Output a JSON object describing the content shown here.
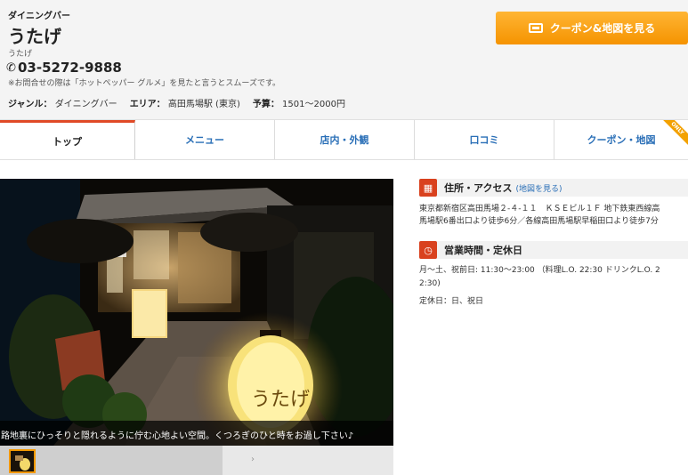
{
  "header": {
    "genre_small": "ダイニングバー",
    "shop_name": "うたげ",
    "shop_kana": "うたげ",
    "phone": "03-5272-9888",
    "phone_note": "※お問合せの際は「ホットペッパー グルメ」を見たと言うとスムーズです。",
    "genre_label": "ジャンル：",
    "genre_value": "ダイニングバー",
    "area_label": "エリア：",
    "area_value": "高田馬場駅 (東京)",
    "budget_label": "予算：",
    "budget_value": "1501～2000円",
    "coupon_button": "クーポン&地図を見る"
  },
  "tabs": [
    {
      "label": "トップ",
      "active": true
    },
    {
      "label": "メニュー"
    },
    {
      "label": "店内・外観"
    },
    {
      "label": "口コミ"
    },
    {
      "label": "クーポン・地図",
      "badge": "ONLY"
    }
  ],
  "photo": {
    "caption": "路地裏にひっそりと隠れるように佇む心地よい空間。くつろぎのひと時をお過し下さい♪",
    "lantern_text": "うたげ",
    "thumbnail_arrow": "›"
  },
  "access": {
    "title": "住所・アクセス",
    "link": "(地図を見る)",
    "line1": "東京都新宿区高田馬場２-４-１１　ＫＳＥビル１Ｆ 地下鉄東西線高",
    "line2": "馬場駅6番出口より徒歩6分／各線高田馬場駅早稲田口より徒歩7分"
  },
  "hours": {
    "title": "営業時間・定休日",
    "line1": "月～土、祝前日: 11:30～23:00 （料理L.O. 22:30 ドリンクL.O. 2",
    "line2": "2:30)",
    "closed": "定休日：日、祝日"
  },
  "colors": {
    "accent_orange": "#f59300",
    "tab_active_border": "#e04a27",
    "link_blue": "#2a6fb7",
    "section_icon": "#d9411e"
  }
}
